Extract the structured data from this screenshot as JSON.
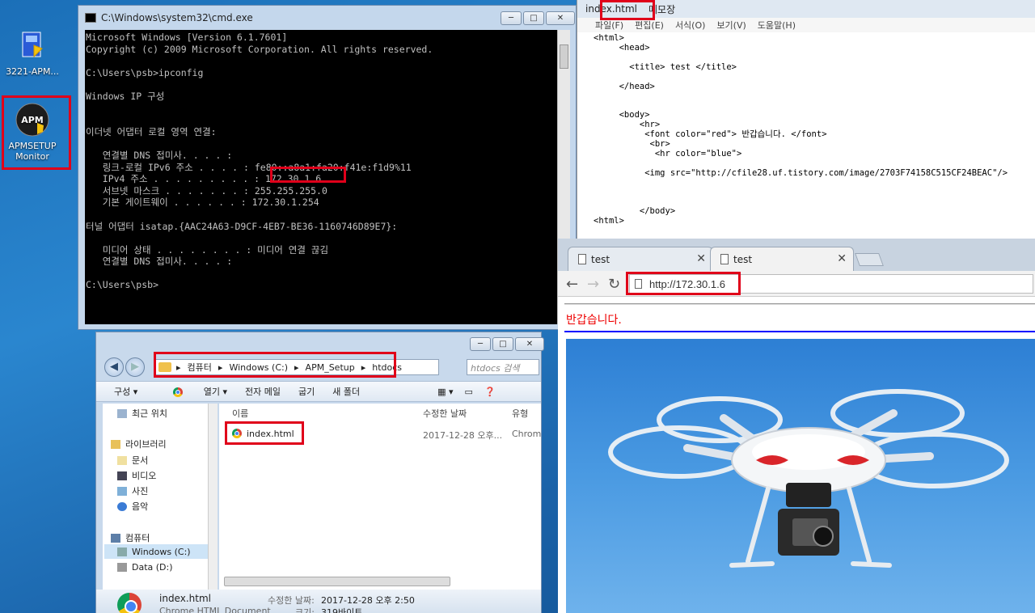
{
  "desktop": {
    "icons": [
      {
        "label": "3221-APM..."
      },
      {
        "label": "APMSETUP Monitor"
      }
    ]
  },
  "cmd": {
    "title": "C:\\Windows\\system32\\cmd.exe",
    "buttons": {
      "minimize": "─",
      "maximize": "□",
      "close": "✕"
    },
    "lines": [
      "Microsoft Windows [Version 6.1.7601]",
      "Copyright (c) 2009 Microsoft Corporation. All rights reserved.",
      "",
      "C:\\Users\\psb>ipconfig",
      "",
      "Windows IP 구성",
      "",
      "",
      "이더넷 어댑터 로컬 영역 연결:",
      "",
      "   연결별 DNS 접미사. . . . :",
      "   링크-로컬 IPv6 주소 . . . . : fe80::a8a1:fa20:f41e:f1d9%11",
      "   IPv4 주소 . . . . . . . . . : 172.30.1.6",
      "   서브넷 마스크 . . . . . . . : 255.255.255.0",
      "   기본 게이트웨이 . . . . . . : 172.30.1.254",
      "",
      "터널 어댑터 isatap.{AAC24A63-D9CF-4EB7-BE36-1160746D89E7}:",
      "",
      "   미디어 상태 . . . . . . . . : 미디어 연결 끊김",
      "   연결별 DNS 접미사. . . . :",
      "",
      "C:\\Users\\psb>"
    ]
  },
  "notepad": {
    "filename": "index.html",
    "app": "메모장",
    "menu": [
      "파일(F)",
      "편집(E)",
      "서식(O)",
      "보기(V)",
      "도움말(H)"
    ],
    "code": "<html>\n     <head>\n\n       <title> test </title>\n\n     </head>\n\n\n     <body>\n         <hr>\n          <font color=\"red\"> 반갑습니다. </font>\n           <br>\n            <hr color=\"blue\">\n\n          <img src=\"http://cfile28.uf.tistory.com/image/2703F74158C515CF24BEAC\"/>\n\n\n\n         </body>\n<html>"
  },
  "chrome": {
    "tabs": [
      {
        "title": "test"
      },
      {
        "title": "test"
      }
    ],
    "tab_close": "✕",
    "url": "http://172.30.1.6",
    "nav": {
      "back": "←",
      "forward": "→",
      "reload": "↻"
    },
    "page_text": "반갑습니다."
  },
  "explorer": {
    "buttons": {
      "minimize": "─",
      "maximize": "□",
      "close": "✕"
    },
    "breadcrumb": [
      "컴퓨터",
      "Windows (C:)",
      "APM_Setup",
      "htdocs"
    ],
    "search_placeholder": "htdocs 검색",
    "toolbar": [
      "구성 ▾",
      "열기 ▾",
      "전자 메일",
      "굽기",
      "새 폴더"
    ],
    "nav_items": [
      "최근 위치",
      "라이브러리",
      "문서",
      "비디오",
      "사진",
      "음악",
      "컴퓨터",
      "Windows (C:)",
      "Data (D:)"
    ],
    "columns": [
      "이름",
      "수정한 날짜",
      "유형"
    ],
    "files": [
      {
        "name": "index.html",
        "modified": "2017-12-28 오후...",
        "type": "Chrom"
      }
    ],
    "details": {
      "name": "index.html",
      "type": "Chrome HTML Document",
      "modified_label": "수정한 날짜:",
      "modified": "2017-12-28 오후 2:50",
      "size_label": "크기:",
      "size": "319바이트"
    }
  }
}
